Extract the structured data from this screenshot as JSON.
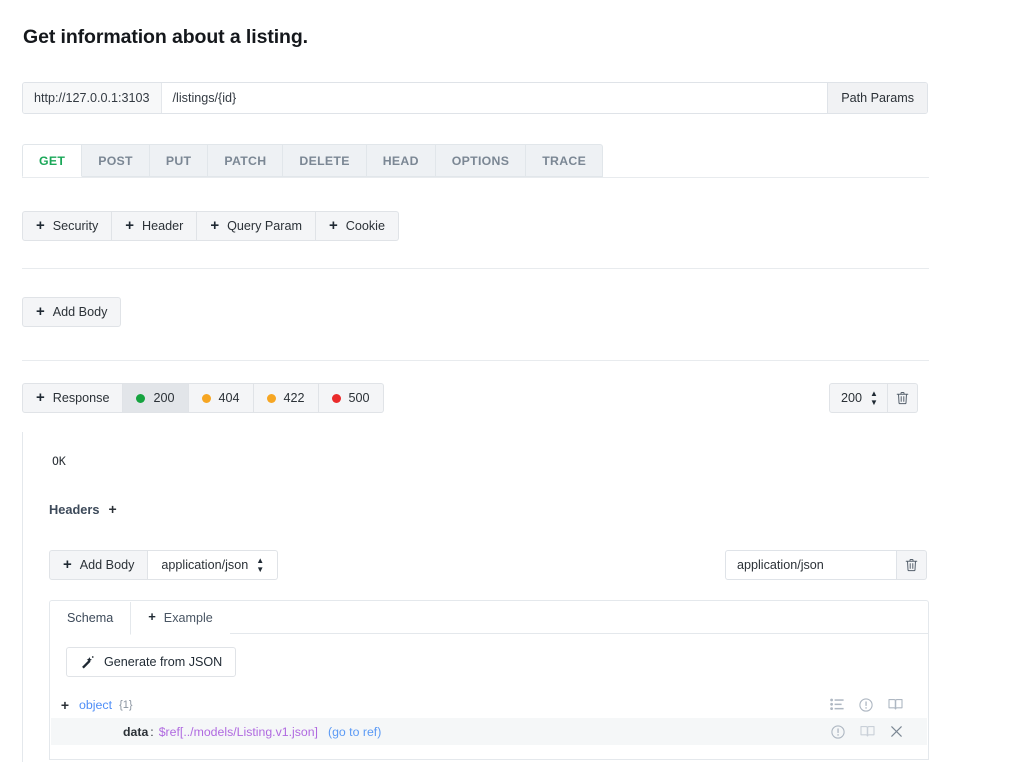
{
  "page": {
    "title": "Get information about a listing."
  },
  "url_bar": {
    "host": "http://127.0.0.1:3103",
    "path": "/listings/{id}",
    "path_params_label": "Path Params"
  },
  "methods": {
    "active": "GET",
    "tabs": [
      {
        "label": "GET",
        "active": true
      },
      {
        "label": "POST",
        "active": false
      },
      {
        "label": "PUT",
        "active": false
      },
      {
        "label": "PATCH",
        "active": false
      },
      {
        "label": "DELETE",
        "active": false
      },
      {
        "label": "HEAD",
        "active": false
      },
      {
        "label": "OPTIONS",
        "active": false
      },
      {
        "label": "TRACE",
        "active": false
      }
    ]
  },
  "request": {
    "auth_buttons": [
      {
        "label": "Security",
        "icon": "plus-icon"
      },
      {
        "label": "Header",
        "icon": "plus-icon"
      },
      {
        "label": "Query Param",
        "icon": "plus-icon"
      },
      {
        "label": "Cookie",
        "icon": "plus-icon"
      }
    ],
    "add_body_label": "Add Body"
  },
  "responses": {
    "add_label": "Response",
    "status_tabs": [
      {
        "code": "200",
        "color": "#15a33f",
        "selected": true
      },
      {
        "code": "404",
        "color": "#f6a623",
        "selected": false
      },
      {
        "code": "422",
        "color": "#f6a623",
        "selected": false
      },
      {
        "code": "500",
        "color": "#ea2b2b",
        "selected": false
      }
    ],
    "status_select_value": "200",
    "delete_icon": "trash-icon"
  },
  "response_detail": {
    "status_text": "OK",
    "headers_label": "Headers",
    "headers_add_icon": "plus-icon",
    "add_body_label": "Add Body",
    "body_media_type": "application/json",
    "media_input_value": "application/json",
    "media_delete_icon": "trash-icon",
    "schema_tabs": [
      {
        "label": "Schema",
        "active": true
      },
      {
        "label": "Example",
        "active": false,
        "icon": "plus-icon"
      }
    ],
    "generate_button": {
      "label": "Generate from JSON",
      "icon": "magic-wand-icon"
    },
    "tree": [
      {
        "expander": "+",
        "type": "object",
        "count": "{1}",
        "icons": [
          "list-icon",
          "info-circle-icon",
          "book-icon"
        ]
      },
      {
        "key": "data",
        "colon": ":",
        "ref": "$ref[../models/Listing.v1.json]",
        "goto": "(go to ref)",
        "icons": [
          "info-circle-icon",
          "book-icon",
          "close-icon"
        ]
      }
    ]
  },
  "colors": {
    "active_method": "#1aa758",
    "ref_purple": "#b06ae0",
    "link_blue": "#5b9af5",
    "type_blue": "#4f8ef7"
  }
}
